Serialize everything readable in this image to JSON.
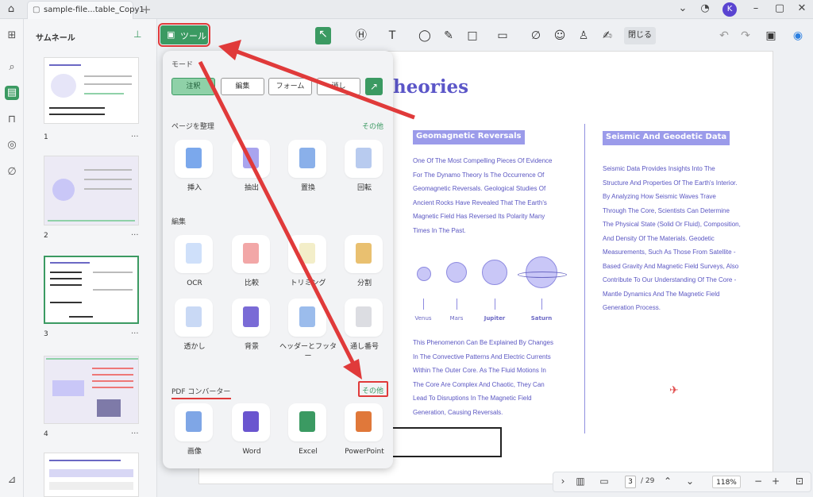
{
  "titlebar": {
    "tab_title": "sample-file...table_Copy1",
    "avatar_letter": "K"
  },
  "thumbnails": {
    "title": "サムネール",
    "pages": [
      {
        "num": "1",
        "more": "..."
      },
      {
        "num": "2",
        "more": "..."
      },
      {
        "num": "3",
        "more": "..."
      },
      {
        "num": "4",
        "more": "..."
      }
    ]
  },
  "toolbar": {
    "tools_label": "ツール",
    "close_label": "閉じる"
  },
  "popup": {
    "mode_title": "モード",
    "modes": [
      "注釈",
      "編集",
      "フォーム",
      "消し"
    ],
    "organize_title": "ページを整理",
    "organize_more": "その他",
    "organize_tools": [
      "挿入",
      "抽出",
      "置換",
      "回転"
    ],
    "edit_title": "編集",
    "edit_tools": [
      "OCR",
      "比較",
      "トリミング",
      "分割",
      "透かし",
      "背景",
      "ヘッダーとフッター",
      "通し番号"
    ],
    "converter_title": "PDF コンバーター",
    "converter_more": "その他",
    "converter_tools": [
      "画像",
      "Word",
      "Excel",
      "PowerPoint"
    ]
  },
  "document": {
    "title": "heories",
    "left_heading": "Geomagnetic Reversals",
    "left_para_1": [
      "One Of The Most Compelling Pieces Of Evidence",
      "For The Dynamo Theory Is The Occurrence Of",
      "Geomagnetic Reversals. Geological Studies Of",
      "Ancient Rocks Have Revealed That The Earth's",
      "Magnetic Field Has Reversed Its Polarity Many",
      "Times In The Past."
    ],
    "planets": [
      "Venus",
      "Mars",
      "Jupiter",
      "Saturn"
    ],
    "left_para_2": [
      "This Phenomenon Can Be Explained By Changes",
      "In The Convective Patterns And Electric Currents",
      "Within The Outer Core. As The Fluid Motions In",
      "The Core Are Complex And Chaotic, They Can",
      "Lead To Disruptions In The Magnetic Field",
      "Generation, Causing Reversals."
    ],
    "right_heading": "Seismic And Geodetic Data",
    "right_para": [
      "Seismic Data Provides Insights Into The",
      "Structure And Properties Of The Earth's Interior.",
      "By Analyzing How Seismic Waves Trave",
      "Through The Core, Scientists Can Determine",
      "The Physical State (Solid Or Fluid), Composition,",
      "And Density Of The Materials. Geodetic",
      "Measurements, Such As Those From Satellite -",
      "Based Gravity And Magnetic Field Surveys, Also",
      "Contribute To Our Understanding Of The Core -",
      "Mantle Dynamics And The Magnetic Field",
      "Generation Process."
    ]
  },
  "statusbar": {
    "page_current": "3",
    "page_total": "/ 29",
    "zoom": "118%"
  },
  "colors": {
    "accent": "#3b9a62",
    "highlight_red": "#e03a3a",
    "doc_text": "#5a56c2"
  }
}
